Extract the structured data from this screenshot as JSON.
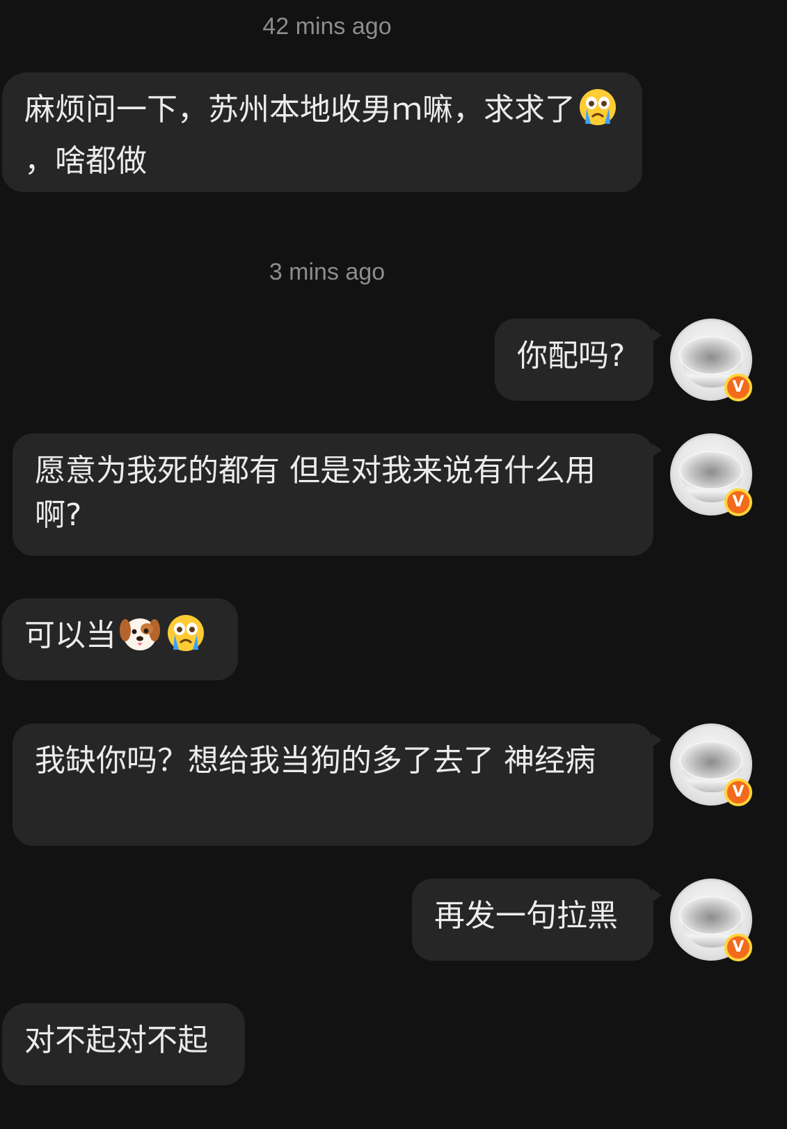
{
  "conversation": {
    "timestamps": [
      "42 mins ago",
      "3 mins ago"
    ],
    "messages": [
      {
        "side": "incoming",
        "parts": [
          "麻烦问一下，苏州本地收男ｍ嘛，求求了",
          "，啥都做"
        ],
        "emojis": [
          "crying-face"
        ]
      },
      {
        "side": "outgoing",
        "text": "你配吗?"
      },
      {
        "side": "outgoing",
        "text": "愿意为我死的都有 但是对我来说有什么用啊?"
      },
      {
        "side": "incoming",
        "parts": [
          "可以当"
        ],
        "emojis": [
          "dog-face",
          "crying-face"
        ]
      },
      {
        "side": "outgoing",
        "text": "我缺你吗？想给我当狗的多了去了 神经病"
      },
      {
        "side": "outgoing",
        "text": "再发一句拉黑"
      },
      {
        "side": "incoming",
        "text": "对不起对不起"
      }
    ]
  },
  "avatar": {
    "badge_letter": "V",
    "badge_color": "#f26a1b",
    "badge_ring": "#ffd43b"
  },
  "colors": {
    "background": "#121212",
    "bubble": "#262626",
    "text": "#ececec",
    "timestamp": "#8d8d8d"
  }
}
